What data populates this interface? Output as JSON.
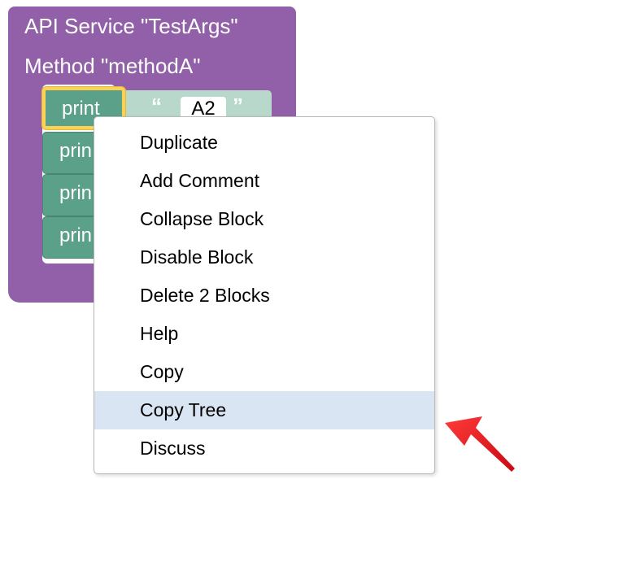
{
  "service_block": {
    "service_title": "API Service \"TestArgs\"",
    "method_title": "Method \"methodA\""
  },
  "print_blocks": [
    {
      "label": "print"
    },
    {
      "label": "prin"
    },
    {
      "label": "prin"
    },
    {
      "label": "prin"
    }
  ],
  "text_block": {
    "open_quote": "“",
    "value": "A2",
    "close_quote": "”"
  },
  "context_menu": {
    "items": [
      {
        "label": "Duplicate"
      },
      {
        "label": "Add Comment"
      },
      {
        "label": "Collapse Block"
      },
      {
        "label": "Disable Block"
      },
      {
        "label": "Delete 2 Blocks"
      },
      {
        "label": "Help"
      },
      {
        "label": "Copy"
      },
      {
        "label": "Copy Tree",
        "highlighted": true
      },
      {
        "label": "Discuss"
      }
    ]
  },
  "colors": {
    "service_block": "#9160a8",
    "print_block": "#5ba088",
    "text_block": "#b8d8cb",
    "selection_outline": "#fbd255",
    "menu_highlight": "#d9e5f3",
    "annotation_arrow": "#e8101a"
  },
  "icons": {
    "annotation": "red-arrow-icon"
  }
}
